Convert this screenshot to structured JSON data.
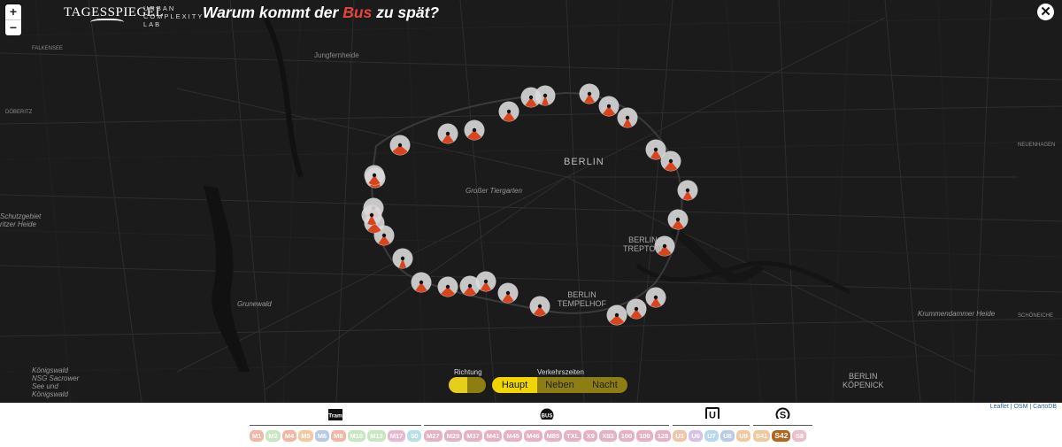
{
  "header": {
    "brand": "TAGESSPIEGEL",
    "lab": "URBAN\nCOMPLEXITY\nLAB",
    "title_pre": "Warum kommt der ",
    "title_bus": "Bus",
    "title_post": " zu spät?",
    "close": "✕"
  },
  "zoom": {
    "in": "+",
    "out": "−"
  },
  "map_labels": {
    "jungfernheide": "Jungfernheide",
    "berlin": "BERLIN",
    "tiergarten": "Großer Tiergarten",
    "treptow": "BERLIN\nTREPTOW",
    "tempelhof": "BERLIN\nTEMPELHOF",
    "koepenick": "BERLIN\nKÖPENICK",
    "grunewald": "Grunewald",
    "krumm": "Krummendammer Heide",
    "schutz": "Schutzgebiet\nritzer Heide",
    "koenigswald": "Königswald\nNSG Sacrower\nSee und\nKönigswald",
    "doebritz": "DÖBERITZ",
    "falkensee": "FALKENSEE",
    "schoeneiche": "SCHÖNEICHE",
    "neuenhagen": "NEUENHAGEN"
  },
  "controls": {
    "richtung": "Richtung",
    "verkehrszeiten": "Verkehrszeiten",
    "times": [
      "Haupt",
      "Neben",
      "Nacht"
    ],
    "active_time": "Haupt"
  },
  "attribution": "Leaflet | OSM | CartoDB",
  "categories": {
    "tram": {
      "label": "Tram",
      "lines": [
        "M1",
        "M2",
        "M4",
        "M5",
        "M6",
        "M8",
        "M10",
        "M13",
        "M17",
        "50"
      ],
      "color": "#f0a99e"
    },
    "bus": {
      "label": "BUS",
      "lines": [
        "M27",
        "M29",
        "M37",
        "M41",
        "M45",
        "M46",
        "M85",
        "TXL",
        "X9",
        "X83",
        "100",
        "109",
        "128"
      ],
      "color": "#e3a9c0"
    },
    "ubahn": {
      "label": "U",
      "lines": [
        "U3",
        "U6",
        "U7",
        "U8",
        "U9"
      ],
      "color": "#e9bba7"
    },
    "sbahn": {
      "label": "S",
      "lines": [
        "S41",
        "S42",
        "S8"
      ],
      "color": "#e9c8a6",
      "active": "S42",
      "active_color": "#b5651d"
    }
  },
  "chip_colors": {
    "M1": "#f3b6a5",
    "M2": "#c8e6c0",
    "M4": "#f3b6a5",
    "M5": "#f2c9a0",
    "M6": "#b8c8e6",
    "M8": "#f3b6a5",
    "M10": "#c8e6c0",
    "M13": "#c8e6c0",
    "M17": "#e8b8d0",
    "50": "#b8e0e6",
    "M27": "#e8b0c4",
    "M29": "#e8b0c4",
    "M37": "#e8b0c4",
    "M41": "#e8b0c4",
    "M45": "#e8b0c4",
    "M46": "#e8b0c4",
    "M85": "#e8b0c4",
    "TXL": "#e8b0c4",
    "X9": "#e8b0c4",
    "X83": "#e8b0c4",
    "100": "#e8b0c4",
    "109": "#e8b0c4",
    "128": "#e8b0c4",
    "U3": "#f2c4a8",
    "U6": "#d8c0e8",
    "U7": "#b8d8f0",
    "U8": "#b8cce6",
    "U9": "#f2c9a0",
    "S41": "#efc8a0",
    "S42": "#b5651d",
    "S8": "#ecc0c8"
  },
  "delay_stops": [
    {
      "stop": 1,
      "delay": 0.12
    },
    {
      "stop": 2,
      "delay": 0.18
    },
    {
      "stop": 3,
      "delay": 0.22
    },
    {
      "stop": 4,
      "delay": 0.15
    },
    {
      "stop": 5,
      "delay": 0.2
    },
    {
      "stop": 6,
      "delay": 0.25
    },
    {
      "stop": 7,
      "delay": 0.2
    },
    {
      "stop": 8,
      "delay": 0.28
    },
    {
      "stop": 9,
      "delay": 0.18
    },
    {
      "stop": 10,
      "delay": 0.22
    },
    {
      "stop": 11,
      "delay": 0.16
    },
    {
      "stop": 12,
      "delay": 0.2
    },
    {
      "stop": 13,
      "delay": 0.24
    },
    {
      "stop": 14,
      "delay": 0.18
    },
    {
      "stop": 15,
      "delay": 0.2
    },
    {
      "stop": 16,
      "delay": 0.26
    },
    {
      "stop": 17,
      "delay": 0.22
    },
    {
      "stop": 18,
      "delay": 0.2
    },
    {
      "stop": 19,
      "delay": 0.18
    },
    {
      "stop": 20,
      "delay": 0.22
    },
    {
      "stop": 21,
      "delay": 0.25
    },
    {
      "stop": 22,
      "delay": 0.2
    },
    {
      "stop": 23,
      "delay": 0.12
    },
    {
      "stop": 24,
      "delay": 0.2
    },
    {
      "stop": 25,
      "delay": 0.24
    },
    {
      "stop": 26,
      "delay": 0.22
    },
    {
      "stop": 27,
      "delay": 0.18
    },
    {
      "stop": 28,
      "delay": 0.2
    },
    {
      "stop": 29,
      "delay": 0.15
    },
    {
      "stop": 30,
      "delay": 0.2
    }
  ],
  "colors": {
    "map_bg": "#1b1b1b",
    "dial": "#d9d9d9",
    "wedge": "#d9441d",
    "accent": "#f0d500"
  }
}
